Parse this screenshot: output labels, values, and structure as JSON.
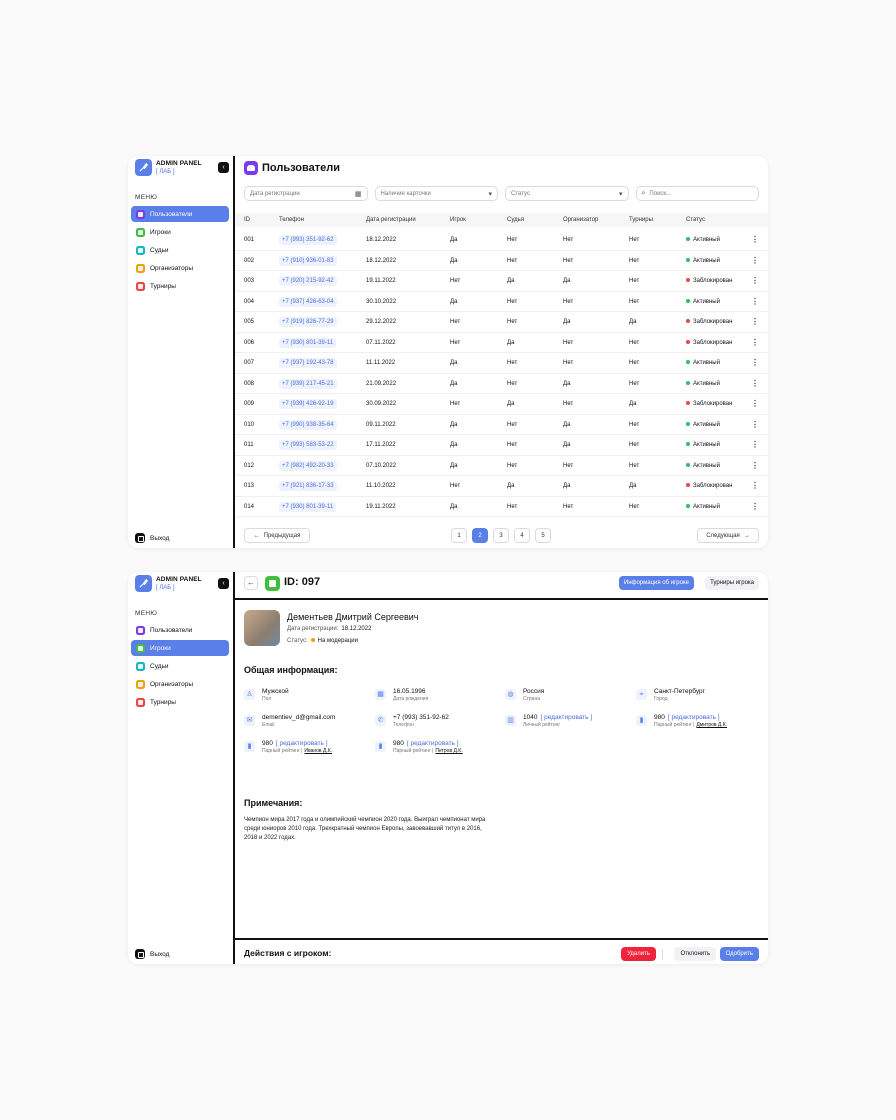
{
  "brand": {
    "title": "ADMIN PANEL",
    "subtitle": "[ ЛАБ ]"
  },
  "sidebar": {
    "menu_label": "МЕНЮ",
    "items": [
      {
        "label": "Пользователи",
        "color": "#7c3aed"
      },
      {
        "label": "Игроки",
        "color": "#3fbf3f"
      },
      {
        "label": "Судьи",
        "color": "#14b8c4"
      },
      {
        "label": "Организаторы",
        "color": "#f59e0b"
      },
      {
        "label": "Турниры",
        "color": "#ef4444"
      }
    ],
    "logout": "Выход"
  },
  "users": {
    "title": "Пользователи",
    "filters": {
      "date": "Дата регистрации",
      "card": "Наличие карточки",
      "status": "Статус",
      "search": "Поиск..."
    },
    "columns": [
      "ID",
      "Телефон",
      "Дата регистрации",
      "Игрок",
      "Судья",
      "Организатор",
      "Турниры",
      "Статус"
    ],
    "rows": [
      [
        "001",
        "+7 (993) 351-92-62",
        "18.12.2022",
        "Да",
        "Нет",
        "Нет",
        "Нет",
        "Активный"
      ],
      [
        "002",
        "+7 (910) 936-01-83",
        "18.12.2022",
        "Да",
        "Нет",
        "Нет",
        "Нет",
        "Активный"
      ],
      [
        "003",
        "+7 (920) 215-92-42",
        "19.11.2022",
        "Нет",
        "Да",
        "Да",
        "Нет",
        "Заблокирован"
      ],
      [
        "004",
        "+7 (937) 426-63-04",
        "30.10.2022",
        "Да",
        "Нет",
        "Нет",
        "Нет",
        "Активный"
      ],
      [
        "005",
        "+7 (919) 826-77-29",
        "29.12.2022",
        "Нет",
        "Нет",
        "Да",
        "Да",
        "Заблокирован"
      ],
      [
        "006",
        "+7 (930) 801-39-11",
        "07.11.2022",
        "Нет",
        "Да",
        "Нет",
        "Нет",
        "Заблокирован"
      ],
      [
        "007",
        "+7 (937) 192-43-78",
        "11.11.2022",
        "Да",
        "Нет",
        "Нет",
        "Нет",
        "Активный"
      ],
      [
        "008",
        "+7 (939) 217-45-21",
        "21.09.2022",
        "Да",
        "Нет",
        "Да",
        "Нет",
        "Активный"
      ],
      [
        "009",
        "+7 (939) 426-92-19",
        "30.09.2022",
        "Нет",
        "Да",
        "Нет",
        "Да",
        "Заблокирован"
      ],
      [
        "010",
        "+7 (990) 938-35-64",
        "09.11.2022",
        "Да",
        "Нет",
        "Да",
        "Нет",
        "Активный"
      ],
      [
        "011",
        "+7 (993) 583-53-22",
        "17.11.2022",
        "Да",
        "Нет",
        "Да",
        "Нет",
        "Активный"
      ],
      [
        "012",
        "+7 (982) 492-20-33",
        "07.10.2022",
        "Да",
        "Нет",
        "Нет",
        "Нет",
        "Активный"
      ],
      [
        "013",
        "+7 (921) 836-17-33",
        "11.10.2022",
        "Нет",
        "Да",
        "Да",
        "Да",
        "Заблокирован"
      ],
      [
        "014",
        "+7 (930) 801-39-11",
        "19.11.2022",
        "Да",
        "Нет",
        "Нет",
        "Нет",
        "Активный"
      ]
    ],
    "pager": {
      "prev": "Предыдущая",
      "next": "Следующая",
      "pages": [
        "1",
        "2",
        "3",
        "4",
        "5"
      ],
      "current": "2"
    }
  },
  "player": {
    "id_title": "ID: 097",
    "tabs": [
      "Информация об игроке",
      "Турниры игрока"
    ],
    "name": "Дементьев Дмитрий Сергеевич",
    "reg_label": "Дата регистрации:",
    "reg_value": "18.12.2022",
    "status_label": "Статус:",
    "status_value": "На модерации",
    "general_title": "Общая информация:",
    "info": [
      {
        "icon": "user-icon",
        "glyph": "♙",
        "value": "Мужской",
        "label": "Пол"
      },
      {
        "icon": "calendar-icon",
        "glyph": "▦",
        "value": "16.05.1996",
        "label": "Дата рождения"
      },
      {
        "icon": "globe-icon",
        "glyph": "◍",
        "value": "Россия",
        "label": "Страна"
      },
      {
        "icon": "location-icon",
        "glyph": "⌖",
        "value": "Санкт-Петербург",
        "label": "Город"
      },
      {
        "icon": "mail-icon",
        "glyph": "✉",
        "value": "dementiev_d@gmail.com",
        "label": "Email"
      },
      {
        "icon": "phone-icon",
        "glyph": "✆",
        "value": "+7 (993) 351-92-62",
        "label": "Телефон"
      },
      {
        "icon": "building-icon",
        "glyph": "▥",
        "value": "1040",
        "edit": "[ редактировать ]",
        "label": "Личный рейтинг"
      },
      {
        "icon": "chart-icon",
        "glyph": "▮",
        "value": "980",
        "edit": "[ редактировать ]",
        "label": "Парный рейтинг |",
        "partner": "Дмитров Д.К."
      },
      {
        "icon": "chart-icon",
        "glyph": "▮",
        "value": "980",
        "edit": "[ редактировать ]",
        "label": "Парный рейтинг |",
        "partner": "Иванов Д.К."
      },
      {
        "icon": "chart-icon",
        "glyph": "▮",
        "value": "980",
        "edit": "[ редактировать ]",
        "label": "Парный рейтинг |",
        "partner": "Петров Д.К."
      }
    ],
    "notes_title": "Примечания:",
    "notes": "Чемпион мира 2017 года и олимпийский чемпион 2020 года. Выиграл чемпионат мира среди юниоров 2010 года. Трехкратный чемпион Европы, завоевавший титул в 2016, 2018 и 2022 годах.",
    "actions_title": "Действия с игроком:",
    "actions": {
      "delete": "Удалить",
      "reject": "Отклонить",
      "approve": "Одобрить"
    }
  },
  "colors": {
    "accent": "#5b7fe8",
    "active": "#22c55e",
    "blocked": "#ef4444",
    "moderation": "#f59e0b",
    "danger": "#ef233c"
  }
}
